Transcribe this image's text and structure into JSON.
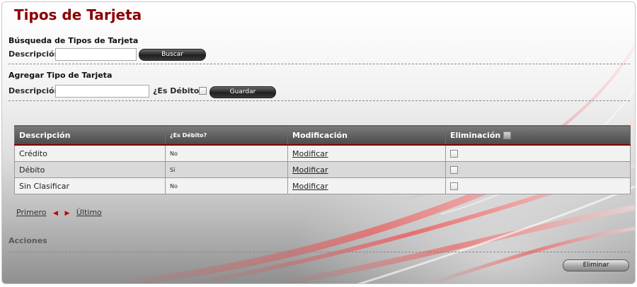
{
  "page": {
    "title": "Tipos de Tarjeta"
  },
  "search": {
    "section_title": "Búsqueda de Tipos de Tarjeta",
    "label": "Descripción",
    "value": "",
    "button": "Buscar"
  },
  "add": {
    "section_title": "Agregar Tipo de Tarjeta",
    "label": "Descripción",
    "value": "",
    "debit_label": "¿Es Débito?",
    "debit_checked": false,
    "button": "Guardar"
  },
  "table": {
    "headers": [
      "Descripción",
      "¿Es Débito?",
      "Modificación",
      "Eliminación"
    ],
    "rows": [
      {
        "descripcion": "Crédito",
        "debito": "No",
        "modificar": "Modificar",
        "eliminar": false
      },
      {
        "descripcion": "Débito",
        "debito": "Sí",
        "modificar": "Modificar",
        "eliminar": false
      },
      {
        "descripcion": "Sin Clasificar",
        "debito": "No",
        "modificar": "Modificar",
        "eliminar": false
      }
    ]
  },
  "pager": {
    "first": "Primero",
    "last": "Último"
  },
  "actions": {
    "title": "Acciones",
    "delete_button": "Eliminar"
  },
  "colors": {
    "title": "#8b0000",
    "accent": "#c40000",
    "header_bg": "#5a5a5a"
  },
  "icons": {
    "prev": "triangle-left-icon",
    "next": "triangle-right-icon"
  }
}
